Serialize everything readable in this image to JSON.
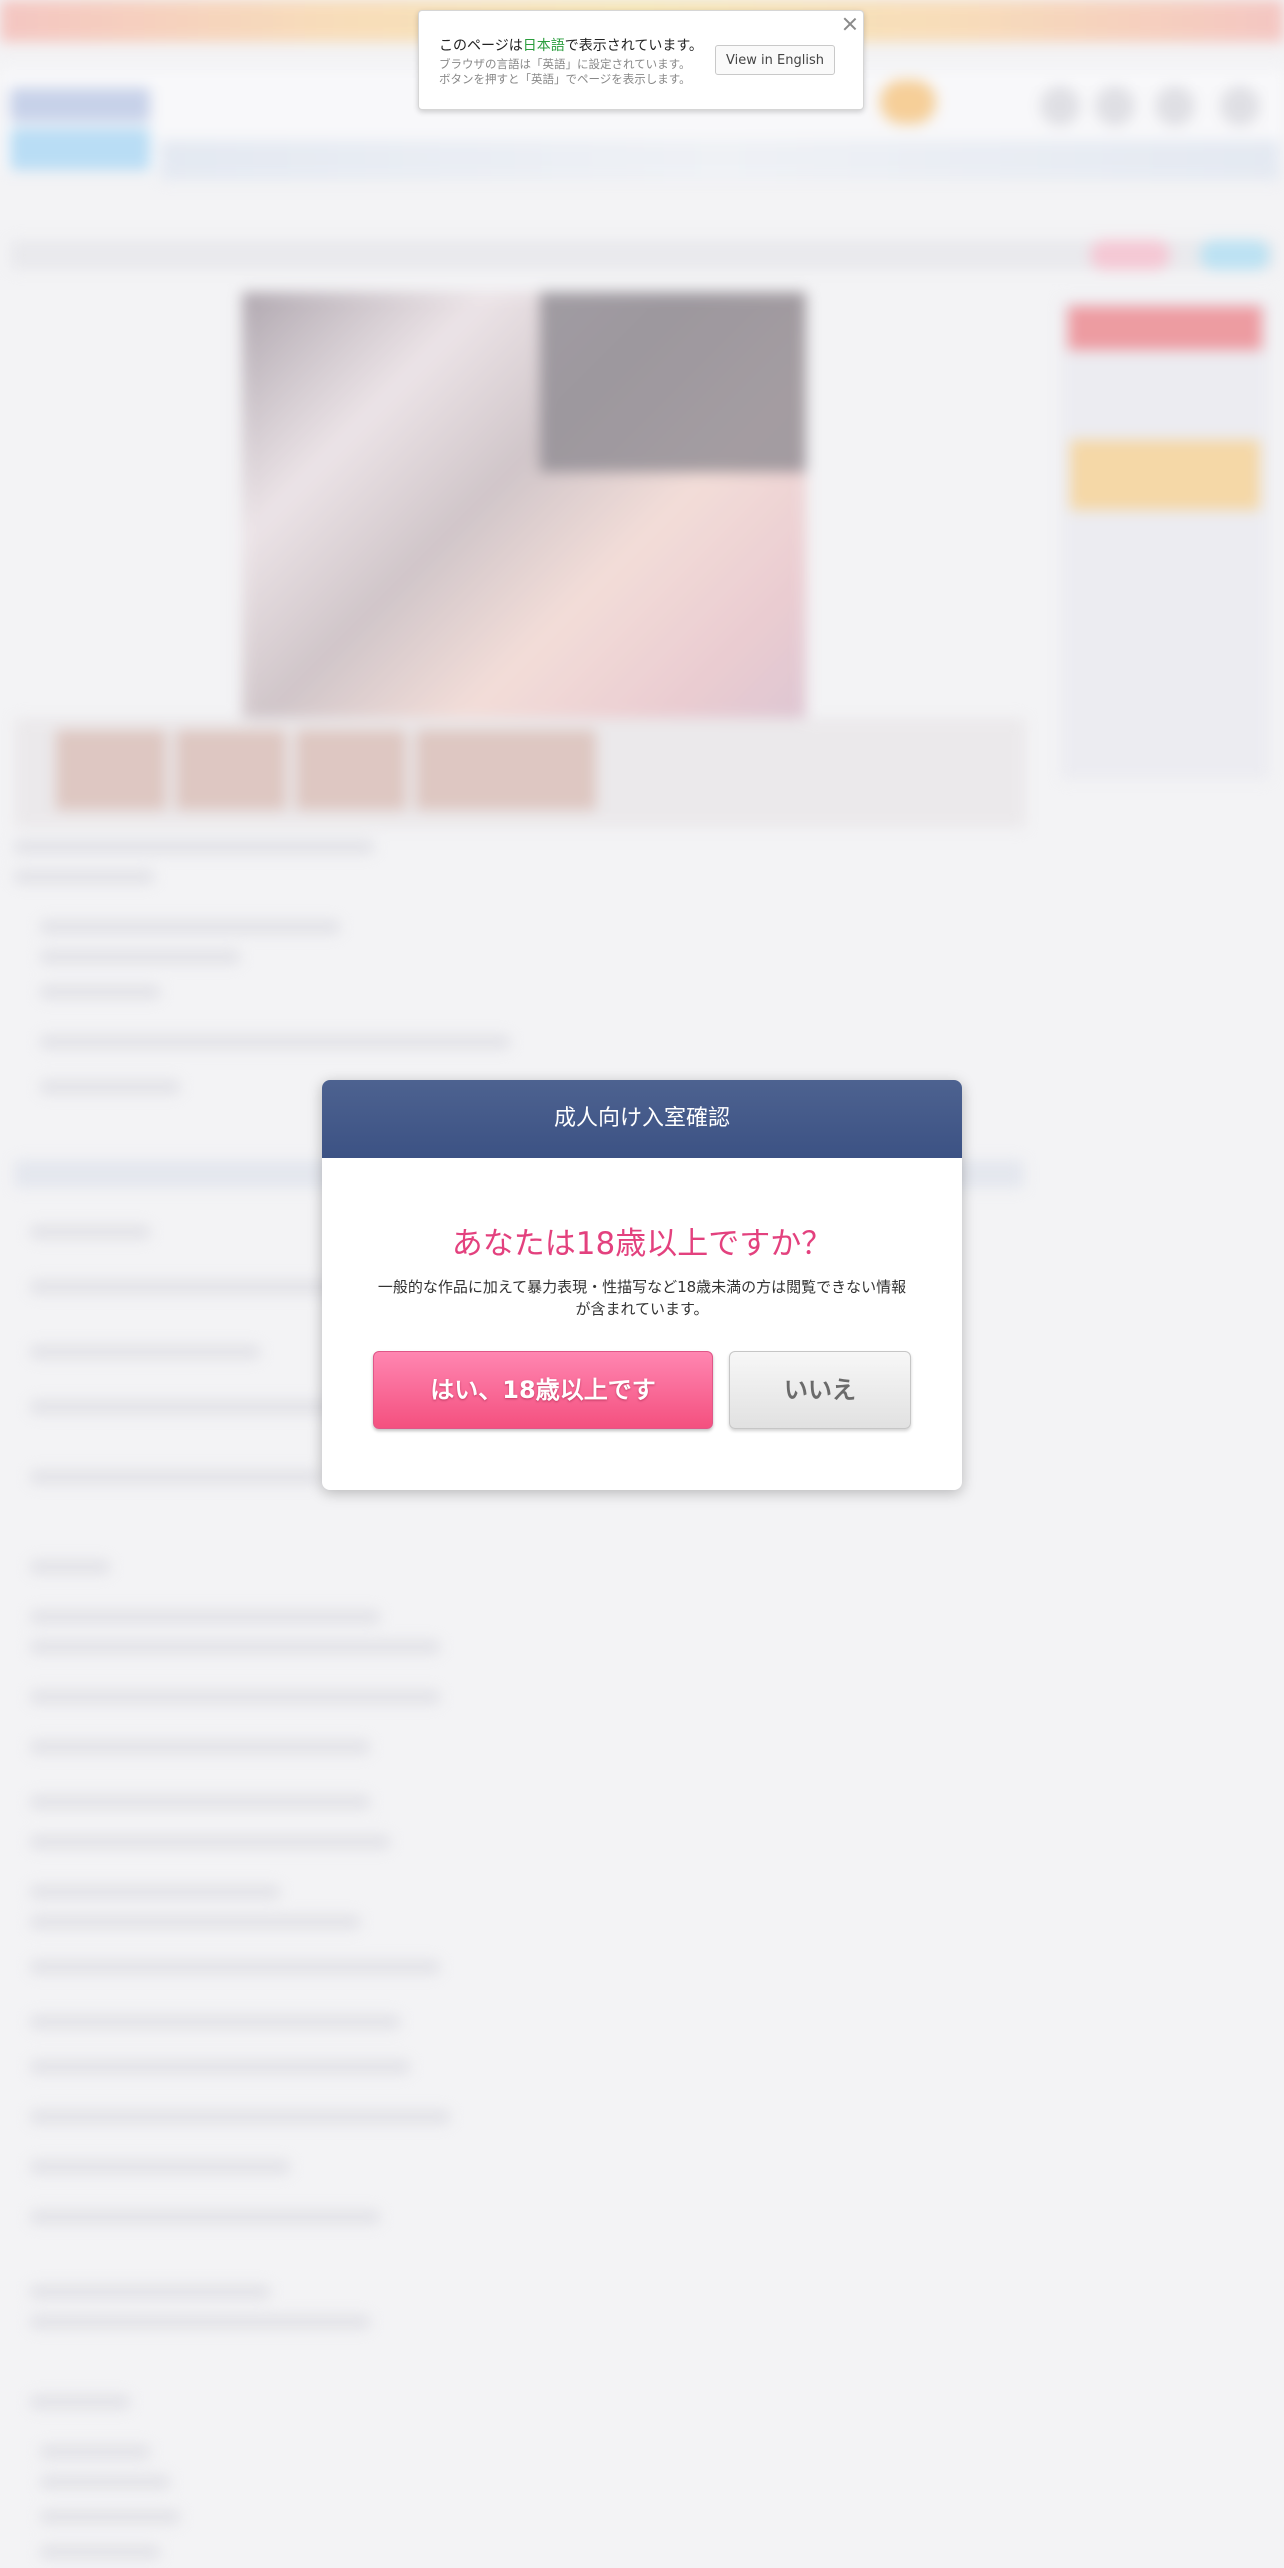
{
  "lang_banner": {
    "text_before": "このページは",
    "language": "日本語",
    "text_after": "で表示されています。",
    "sub_line1": "ブラウザの言語は「英語」に設定されています。",
    "sub_line2": "ボタンを押すと「英語」でページを表示します。",
    "button": "View in English"
  },
  "age_modal": {
    "title": "成人向け入室確認",
    "question": "あなたは18歳以上ですか？",
    "description_line1": "一般的な作品に加えて暴力表現・性描写など18歳未満の方は閲覧できない情報",
    "description_line2": "が含まれています。",
    "yes_button": "はい、18歳以上です",
    "no_button": "いいえ"
  },
  "colors": {
    "modal_header": "#42578a",
    "question_pink": "#e3417e",
    "yes_button": "#f76596",
    "language_green": "#2a9d3c"
  }
}
